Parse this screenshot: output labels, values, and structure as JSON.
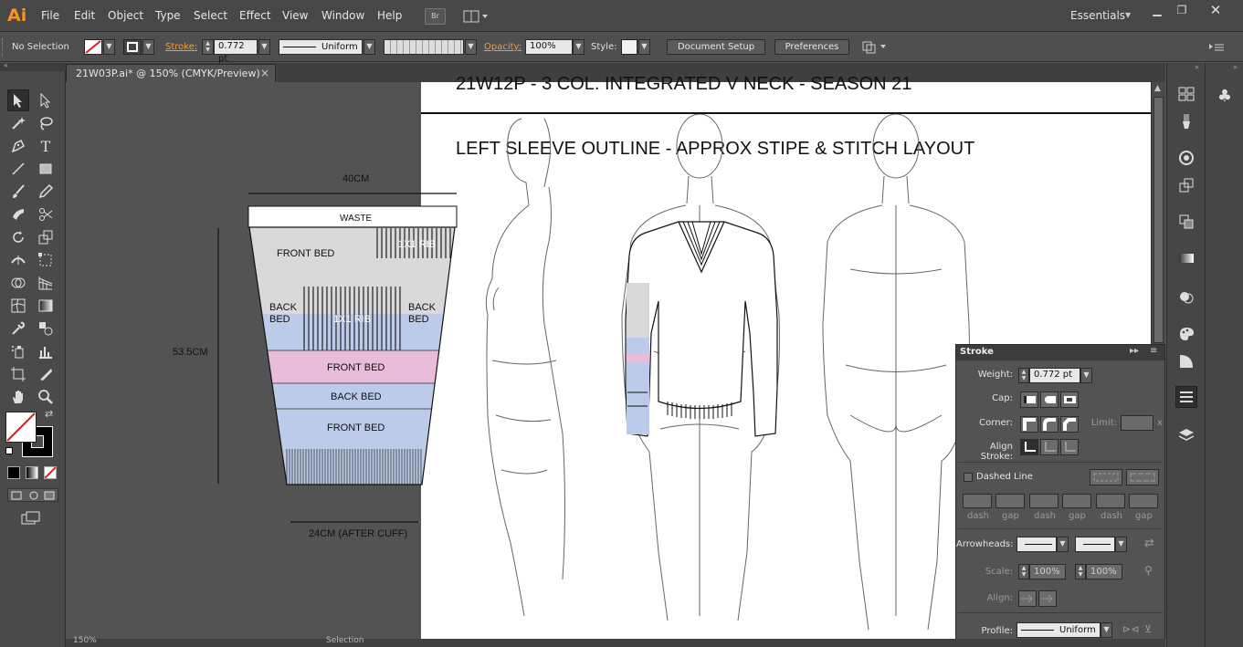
{
  "app": {
    "logo": "Ai",
    "workspace": "Essentials",
    "bridge_label": "Br"
  },
  "menu": [
    "File",
    "Edit",
    "Object",
    "Type",
    "Select",
    "Effect",
    "View",
    "Window",
    "Help"
  ],
  "controlbar": {
    "selection": "No Selection",
    "stroke_label": "Stroke:",
    "stroke_value": "0.772 pt",
    "profile": "Uniform",
    "opacity_label": "Opacity:",
    "opacity_value": "100%",
    "style_label": "Style:",
    "document_setup": "Document Setup",
    "preferences": "Preferences"
  },
  "document": {
    "tab_title": "21W03P.ai* @ 150% (CMYK/Preview)",
    "close": "×"
  },
  "artboard": {
    "title_line1": "21W12P - 3 COL. INTEGRATED V NECK - SEASON 21",
    "title_line2": "LEFT SLEEVE OUTLINE - APPROX STIPE & STITCH LAYOUT"
  },
  "sleeve": {
    "width_top": "40CM",
    "height": "53.5CM",
    "width_bottom": "24CM (AFTER CUFF)",
    "waste": "WASTE",
    "front_bed_1": "FRONT BED",
    "rib_top": "1X1 RIB",
    "back_bed_left": "BACK BED",
    "rib_mid": "1X1 RIB",
    "back_bed_right": "BACK BED",
    "front_bed_pink": "FRONT BED",
    "back_bed_blue": "BACK BED",
    "front_bed_blue": "FRONT BED",
    "colors": {
      "grey": "#d9d9d9",
      "blue": "#bccbe9",
      "pink": "#e9bcd9"
    }
  },
  "stroke_panel": {
    "title": "Stroke",
    "weight_label": "Weight:",
    "weight_value": "0.772 pt",
    "cap_label": "Cap:",
    "corner_label": "Corner:",
    "limit_label": "Limit:",
    "limit_unit": "x",
    "align_label": "Align Stroke:",
    "dashed_label": "Dashed Line",
    "dash_labels": [
      "dash",
      "gap",
      "dash",
      "gap",
      "dash",
      "gap"
    ],
    "arrowheads_label": "Arrowheads:",
    "scale_label": "Scale:",
    "scale_1": "100%",
    "scale_2": "100%",
    "align_label2": "Align:",
    "profile_label": "Profile:",
    "profile_value": "Uniform"
  },
  "statusbar": {
    "zoom": "150%",
    "tool": "Selection"
  }
}
